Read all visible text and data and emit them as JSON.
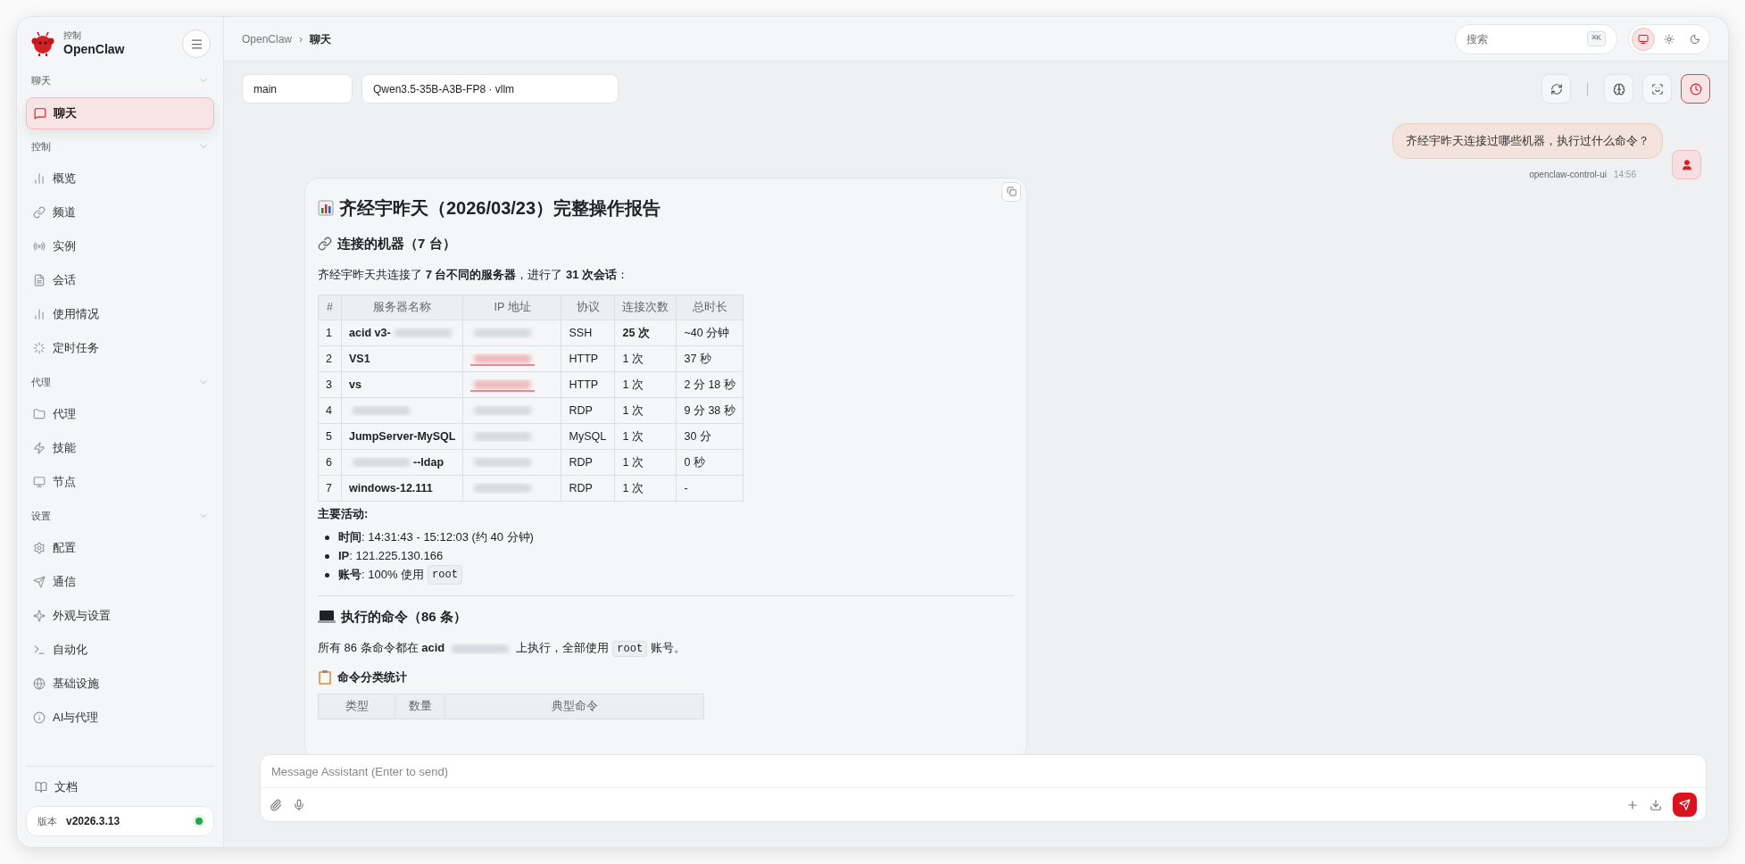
{
  "app": {
    "subtitle": "控制",
    "name": "OpenClaw"
  },
  "sidebar": {
    "sections": [
      {
        "title": "聊天",
        "items": [
          {
            "label": "聊天",
            "selected": true
          }
        ]
      },
      {
        "title": "控制",
        "items": [
          {
            "label": "概览",
            "selected": false
          },
          {
            "label": "频道",
            "selected": false
          },
          {
            "label": "实例",
            "selected": false
          },
          {
            "label": "会话",
            "selected": false
          },
          {
            "label": "使用情况",
            "selected": false
          },
          {
            "label": "定时任务",
            "selected": false
          }
        ]
      },
      {
        "title": "代理",
        "items": [
          {
            "label": "代理",
            "selected": false
          },
          {
            "label": "技能",
            "selected": false
          },
          {
            "label": "节点",
            "selected": false
          }
        ]
      },
      {
        "title": "设置",
        "items": [
          {
            "label": "配置",
            "selected": false
          },
          {
            "label": "通信",
            "selected": false
          },
          {
            "label": "外观与设置",
            "selected": false
          },
          {
            "label": "自动化",
            "selected": false
          },
          {
            "label": "基础设施",
            "selected": false
          },
          {
            "label": "AI与代理",
            "selected": false
          }
        ]
      }
    ],
    "docs": "文档",
    "version": {
      "label": "版本",
      "value": "v2026.3.13",
      "online": true
    }
  },
  "breadcrumb": [
    "OpenClaw",
    "聊天"
  ],
  "breadcrumb_separator": "›",
  "search": {
    "placeholder": "搜索",
    "shortcut": "⌘K"
  },
  "theme_options": [
    {
      "selected": true
    },
    {
      "selected": false
    },
    {
      "selected": false
    }
  ],
  "session": "main",
  "model": "Qwen3.5-35B-A3B-FP8 · vllm",
  "toolbar_buttons": [
    {
      "on": false
    },
    {
      "on": false
    },
    {
      "on": false
    },
    {
      "on": true
    }
  ],
  "user_message": {
    "text": "齐经宇昨天连接过哪些机器，执行过什么命令？",
    "sender": "openclaw-control-ui",
    "time": "14:56"
  },
  "report": [
    {
      "kind": "title",
      "text": "齐经宇昨天（2026/03/23）完整操作报告"
    },
    {
      "kind": "heading",
      "text": "连接的机器（7 台）"
    },
    {
      "kind": "paragraph",
      "parts": [
        {
          "kind": "text",
          "text": "齐经宇昨天共连接了 **7 台不同的服务器**，进行了 **31 次会话**："
        }
      ]
    },
    {
      "kind": "table",
      "columns": [
        "#",
        "服务器名称",
        "IP  地址",
        "协议",
        "连接次数",
        "总时长"
      ],
      "rows": [
        [
          {
            "text": "1"
          },
          {
            "text": "acid v3-",
            "redacted": true
          },
          {
            "redacted": true
          },
          {
            "text": "SSH"
          },
          {
            "text": "25 次",
            "bold": true
          },
          {
            "text": "~40 分钟"
          }
        ],
        [
          {
            "text": "2"
          },
          {
            "text": "VS1"
          },
          {
            "redacted": true,
            "link": true
          },
          {
            "text": "HTTP"
          },
          {
            "text": "1 次"
          },
          {
            "text": "37 秒"
          }
        ],
        [
          {
            "text": "3"
          },
          {
            "text": "vs"
          },
          {
            "redacted": true,
            "link": true
          },
          {
            "text": "HTTP"
          },
          {
            "text": "1 次"
          },
          {
            "text": "2 分 18 秒"
          }
        ],
        [
          {
            "text": "4"
          },
          {
            "redacted": true
          },
          {
            "redacted": true
          },
          {
            "text": "RDP"
          },
          {
            "text": "1 次"
          },
          {
            "text": "9 分 38 秒"
          }
        ],
        [
          {
            "text": "5"
          },
          {
            "text": "JumpServer-MySQL"
          },
          {
            "redacted": true
          },
          {
            "text": "MySQL"
          },
          {
            "text": "1 次"
          },
          {
            "text": "30 分"
          }
        ],
        [
          {
            "text": "6"
          },
          {
            "text": "--ldap",
            "redacted": true,
            "redaction_first": true
          },
          {
            "redacted": true
          },
          {
            "text": "RDP"
          },
          {
            "text": "1 次"
          },
          {
            "text": "0 秒"
          }
        ],
        [
          {
            "text": "7"
          },
          {
            "text": "windows-12.111"
          },
          {
            "redacted": true
          },
          {
            "text": "RDP"
          },
          {
            "text": "1 次"
          },
          {
            "text": "-"
          }
        ]
      ]
    },
    {
      "kind": "label",
      "text": "主要活动:"
    },
    {
      "kind": "list",
      "items": [
        [
          {
            "kind": "text",
            "text": "**时间**: 14:31:43 - 15:12:03 (约 40 分钟)"
          }
        ],
        [
          {
            "kind": "text",
            "text": "**IP**: 121.225.130.166"
          }
        ],
        [
          {
            "kind": "text",
            "text": "**账号**: 100% 使用"
          },
          {
            "kind": "code",
            "text": "root"
          }
        ]
      ]
    },
    {
      "kind": "rule"
    },
    {
      "kind": "heading",
      "text": "执行的命令（86 条）"
    },
    {
      "kind": "paragraph",
      "parts": [
        {
          "kind": "text",
          "text": "所有 86 条命令都在 **acid**"
        },
        {
          "kind": "redacted"
        },
        {
          "kind": "text",
          "text": "上执行，全部使用"
        },
        {
          "kind": "code",
          "text": "root"
        },
        {
          "kind": "text",
          "text": "账号。"
        }
      ]
    },
    {
      "kind": "subheading",
      "text": "命令分类统计"
    },
    {
      "kind": "table",
      "columns": [
        "类型",
        "数量",
        "典型命令"
      ]
    }
  ],
  "composer": {
    "placeholder": "Message Assistant (Enter to send)"
  }
}
